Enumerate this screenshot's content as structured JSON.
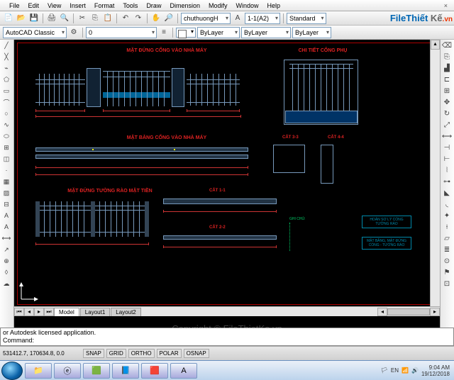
{
  "menu": {
    "file": "File",
    "edit": "Edit",
    "view": "View",
    "insert": "Insert",
    "format": "Format",
    "tools": "Tools",
    "draw": "Draw",
    "dimension": "Dimension",
    "modify": "Modify",
    "window": "Window",
    "help": "Help",
    "close": "×"
  },
  "toolbar2": {
    "workspace": "AutoCAD Classic",
    "textstyle": "chuthuongH",
    "dimstyle": "1-1(A2)",
    "standard": "Standard"
  },
  "toolbar3": {
    "layer": "0",
    "bylayer1": "ByLayer",
    "bylayer2": "ByLayer",
    "bylayer3": "ByLayer"
  },
  "logo": {
    "file": "File",
    "thiet": "Thiết",
    "ke": "Kế",
    "vn": ".vn"
  },
  "drawing": {
    "t1": "MẶT ĐỨNG CỔNG VÀO NHÀ MÁY",
    "t2": "CHI TIẾT CỔNG PHỤ",
    "t3": "MẶT BẰNG CỔNG VÀO NHÀ MÁY",
    "t4": "MẶT ĐỨNG TƯỜNG RÀO MẶT TIỀN",
    "s1": "CẮT 3-3",
    "s2": "CẮT 4-4",
    "s3": "CẮT 1-1",
    "s4": "CẮT 2-2",
    "note": "GHI CHÚ:",
    "box1": "HOÀN SƠ LÝ\nCỔNG TƯỜNG RÀO",
    "box2": "MẶT BẰNG, MẶT ĐỨNG\nCỔNG - TƯỜNG RÀO"
  },
  "layout": {
    "model": "Model",
    "l1": "Layout1",
    "l2": "Layout2"
  },
  "cmd": {
    "line1": "or Autodesk licensed application.",
    "line2": "Command:"
  },
  "status": {
    "coord": "531412.7, 170634.8, 0.0",
    "snap": "SNAP",
    "grid": "GRID",
    "ortho": "ORTHO",
    "polar": "POLAR",
    "osnap": "OSNAP"
  },
  "watermark": "Copyright © FileThietKe.vn",
  "tray": {
    "lang": "EN",
    "time": "9:04 AM",
    "date": "19/12/2018"
  }
}
